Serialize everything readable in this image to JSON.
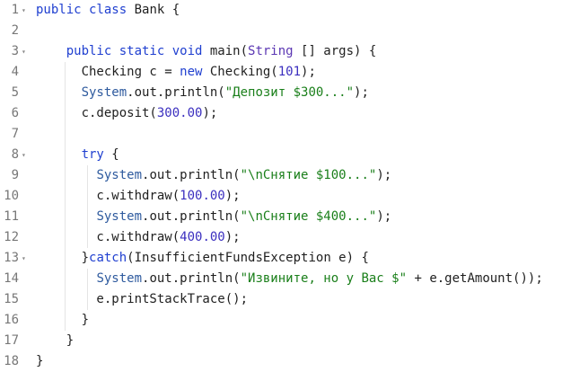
{
  "editor": {
    "fold_glyph": "▾",
    "lines": [
      {
        "no": "1",
        "fold": true,
        "tokens": [
          {
            "t": "public class",
            "c": "kw"
          },
          {
            "t": " Bank {",
            "c": ""
          }
        ]
      },
      {
        "no": "2",
        "fold": false,
        "tokens": []
      },
      {
        "no": "3",
        "fold": true,
        "tokens": [
          {
            "t": "    ",
            "c": ""
          },
          {
            "t": "public static void",
            "c": "kw"
          },
          {
            "t": " main(",
            "c": ""
          },
          {
            "t": "String",
            "c": "cls"
          },
          {
            "t": " [] args) {",
            "c": ""
          }
        ]
      },
      {
        "no": "4",
        "fold": false,
        "tokens": [
          {
            "t": "      Checking c = ",
            "c": ""
          },
          {
            "t": "new",
            "c": "kw"
          },
          {
            "t": " Checking(",
            "c": ""
          },
          {
            "t": "101",
            "c": "num"
          },
          {
            "t": ");",
            "c": ""
          }
        ]
      },
      {
        "no": "5",
        "fold": false,
        "tokens": [
          {
            "t": "      ",
            "c": ""
          },
          {
            "t": "System",
            "c": "sys"
          },
          {
            "t": ".out.println(",
            "c": ""
          },
          {
            "t": "\"Депозит $300...\"",
            "c": "str"
          },
          {
            "t": ");",
            "c": ""
          }
        ]
      },
      {
        "no": "6",
        "fold": false,
        "tokens": [
          {
            "t": "      c.deposit(",
            "c": ""
          },
          {
            "t": "300.00",
            "c": "num"
          },
          {
            "t": ");",
            "c": ""
          }
        ]
      },
      {
        "no": "7",
        "fold": false,
        "tokens": []
      },
      {
        "no": "8",
        "fold": true,
        "tokens": [
          {
            "t": "      ",
            "c": ""
          },
          {
            "t": "try",
            "c": "kw"
          },
          {
            "t": " {",
            "c": ""
          }
        ]
      },
      {
        "no": "9",
        "fold": false,
        "tokens": [
          {
            "t": "        ",
            "c": ""
          },
          {
            "t": "System",
            "c": "sys"
          },
          {
            "t": ".out.println(",
            "c": ""
          },
          {
            "t": "\"\\nСнятие $100...\"",
            "c": "str"
          },
          {
            "t": ");",
            "c": ""
          }
        ]
      },
      {
        "no": "10",
        "fold": false,
        "tokens": [
          {
            "t": "        c.withdraw(",
            "c": ""
          },
          {
            "t": "100.00",
            "c": "num"
          },
          {
            "t": ");",
            "c": ""
          }
        ]
      },
      {
        "no": "11",
        "fold": false,
        "tokens": [
          {
            "t": "        ",
            "c": ""
          },
          {
            "t": "System",
            "c": "sys"
          },
          {
            "t": ".out.println(",
            "c": ""
          },
          {
            "t": "\"\\nСнятие $400...\"",
            "c": "str"
          },
          {
            "t": ");",
            "c": ""
          }
        ]
      },
      {
        "no": "12",
        "fold": false,
        "tokens": [
          {
            "t": "        c.withdraw(",
            "c": ""
          },
          {
            "t": "400.00",
            "c": "num"
          },
          {
            "t": ");",
            "c": ""
          }
        ]
      },
      {
        "no": "13",
        "fold": true,
        "tokens": [
          {
            "t": "      }",
            "c": ""
          },
          {
            "t": "catch",
            "c": "kw"
          },
          {
            "t": "(InsufficientFundsException e) {",
            "c": ""
          }
        ]
      },
      {
        "no": "14",
        "fold": false,
        "tokens": [
          {
            "t": "        ",
            "c": ""
          },
          {
            "t": "System",
            "c": "sys"
          },
          {
            "t": ".out.println(",
            "c": ""
          },
          {
            "t": "\"Извините, но у Вас $\"",
            "c": "str"
          },
          {
            "t": " + e.getAmount());",
            "c": ""
          }
        ]
      },
      {
        "no": "15",
        "fold": false,
        "tokens": [
          {
            "t": "        e.printStackTrace();",
            "c": ""
          }
        ]
      },
      {
        "no": "16",
        "fold": false,
        "tokens": [
          {
            "t": "      }",
            "c": ""
          }
        ]
      },
      {
        "no": "17",
        "fold": false,
        "tokens": [
          {
            "t": "    }",
            "c": ""
          }
        ]
      },
      {
        "no": "18",
        "fold": false,
        "tokens": [
          {
            "t": "}",
            "c": ""
          }
        ]
      }
    ]
  }
}
